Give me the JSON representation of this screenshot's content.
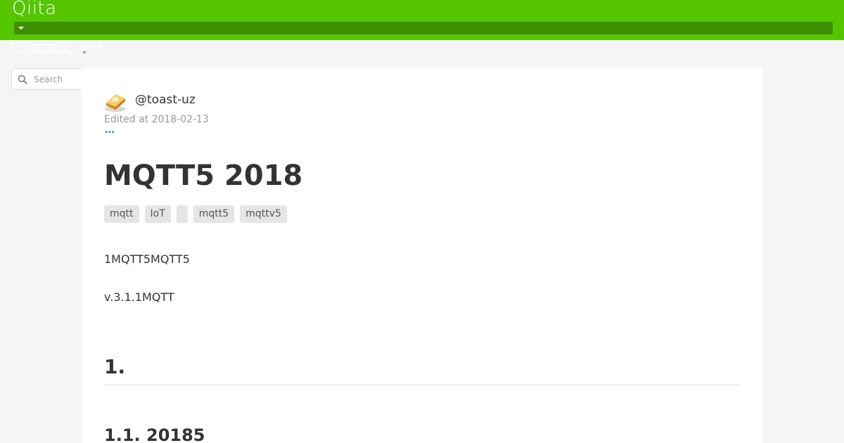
{
  "header": {
    "logo": "Qiita",
    "signup_label": "Sign up",
    "login_label": "Log in",
    "community_label": "Community"
  },
  "search": {
    "placeholder": "Search"
  },
  "article": {
    "author": "@toast-uz",
    "edited": "Edited at 2018-02-13",
    "more": "•••",
    "title": "MQTT5 2018",
    "tags": [
      "mqtt",
      "IoT",
      "",
      "mqtt5",
      "mqttv5"
    ],
    "paragraphs": [
      "1MQTT5MQTT5",
      "v.3.1.1MQTT"
    ],
    "heading_1": "1.",
    "heading_1_1": "1.1. 20185"
  },
  "colors": {
    "brand": "#55c500",
    "brand_dark": "#3f8f00",
    "link": "#337ab7"
  }
}
